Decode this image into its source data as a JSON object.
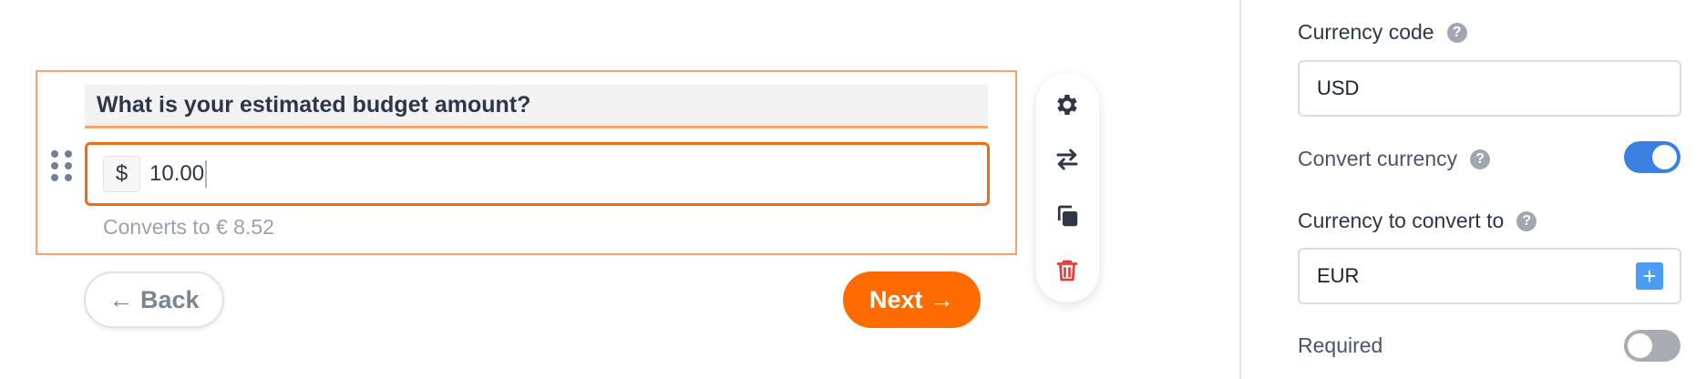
{
  "question": {
    "title": "What is your estimated budget amount?",
    "currency_symbol": "$",
    "value": "10.00",
    "conversion_hint": "Converts to € 8.52"
  },
  "navigation": {
    "back_label": "← Back",
    "next_label": "Next →"
  },
  "toolbar": {
    "items": [
      "gear-icon",
      "swap-arrows-icon",
      "copy-icon",
      "trash-icon"
    ]
  },
  "settings": {
    "currency_code_label": "Currency code",
    "currency_code_value": "USD",
    "convert_currency_label": "Convert currency",
    "convert_currency_enabled": true,
    "convert_to_label": "Currency to convert to",
    "convert_to_value": "EUR",
    "required_label": "Required",
    "required_enabled": false,
    "help_glyph": "?",
    "add_glyph": "+"
  },
  "colors": {
    "accent": "#ff6b00",
    "block_border": "#f9a36a",
    "toggle_on": "#3b7fe0",
    "toggle_off": "#a9adb3",
    "delete": "#e53e3e"
  }
}
